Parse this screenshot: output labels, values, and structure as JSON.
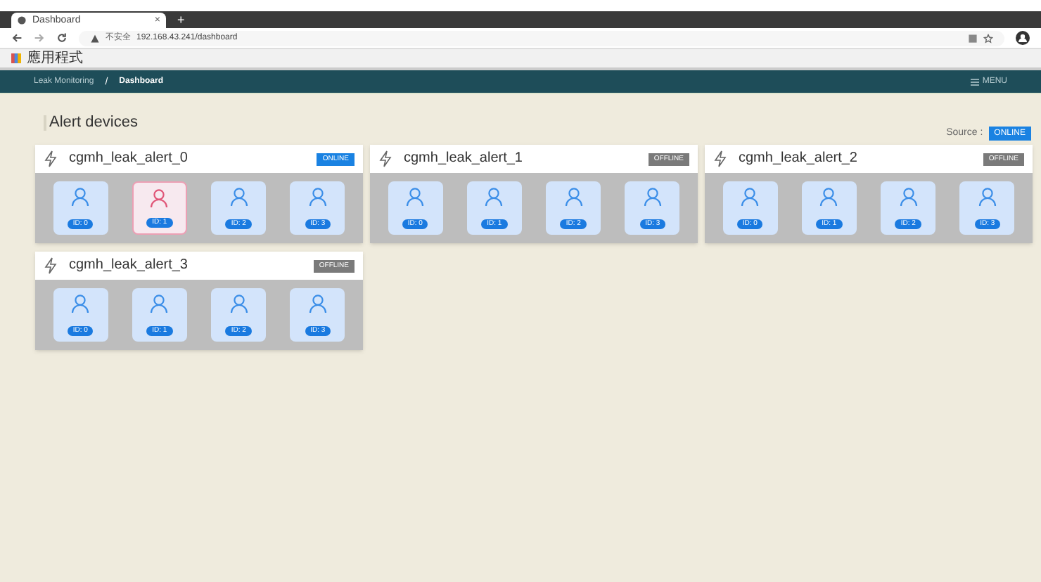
{
  "browser": {
    "tab_title": "Dashboard",
    "tab_close": "×",
    "new_tab": "+",
    "security": "不安全",
    "url": "192.168.43.241/dashboard",
    "bookmark": "應用程式"
  },
  "nav": {
    "breadcrumbs": [
      "Leak Monitoring",
      "Dashboard"
    ],
    "separator": "/",
    "menu": "MENU"
  },
  "page": {
    "title": "Alert devices",
    "source_label": "Source :",
    "source_status": "ONLINE",
    "source_online": true
  },
  "devices": [
    {
      "name": "cgmh_leak_alert_0",
      "status": "ONLINE",
      "online": true,
      "sensors": [
        {
          "id": "ID: 0",
          "alert": false
        },
        {
          "id": "ID: 1",
          "alert": true
        },
        {
          "id": "ID: 2",
          "alert": false
        },
        {
          "id": "ID: 3",
          "alert": false
        }
      ]
    },
    {
      "name": "cgmh_leak_alert_1",
      "status": "OFFLINE",
      "online": false,
      "sensors": [
        {
          "id": "ID: 0",
          "alert": false
        },
        {
          "id": "ID: 1",
          "alert": false
        },
        {
          "id": "ID: 2",
          "alert": false
        },
        {
          "id": "ID: 3",
          "alert": false
        }
      ]
    },
    {
      "name": "cgmh_leak_alert_2",
      "status": "OFFLINE",
      "online": false,
      "sensors": [
        {
          "id": "ID: 0",
          "alert": false
        },
        {
          "id": "ID: 1",
          "alert": false
        },
        {
          "id": "ID: 2",
          "alert": false
        },
        {
          "id": "ID: 3",
          "alert": false
        }
      ]
    },
    {
      "name": "cgmh_leak_alert_3",
      "status": "OFFLINE",
      "online": false,
      "sensors": [
        {
          "id": "ID: 0",
          "alert": false
        },
        {
          "id": "ID: 1",
          "alert": false
        },
        {
          "id": "ID: 2",
          "alert": false
        },
        {
          "id": "ID: 3",
          "alert": false
        }
      ]
    }
  ]
}
